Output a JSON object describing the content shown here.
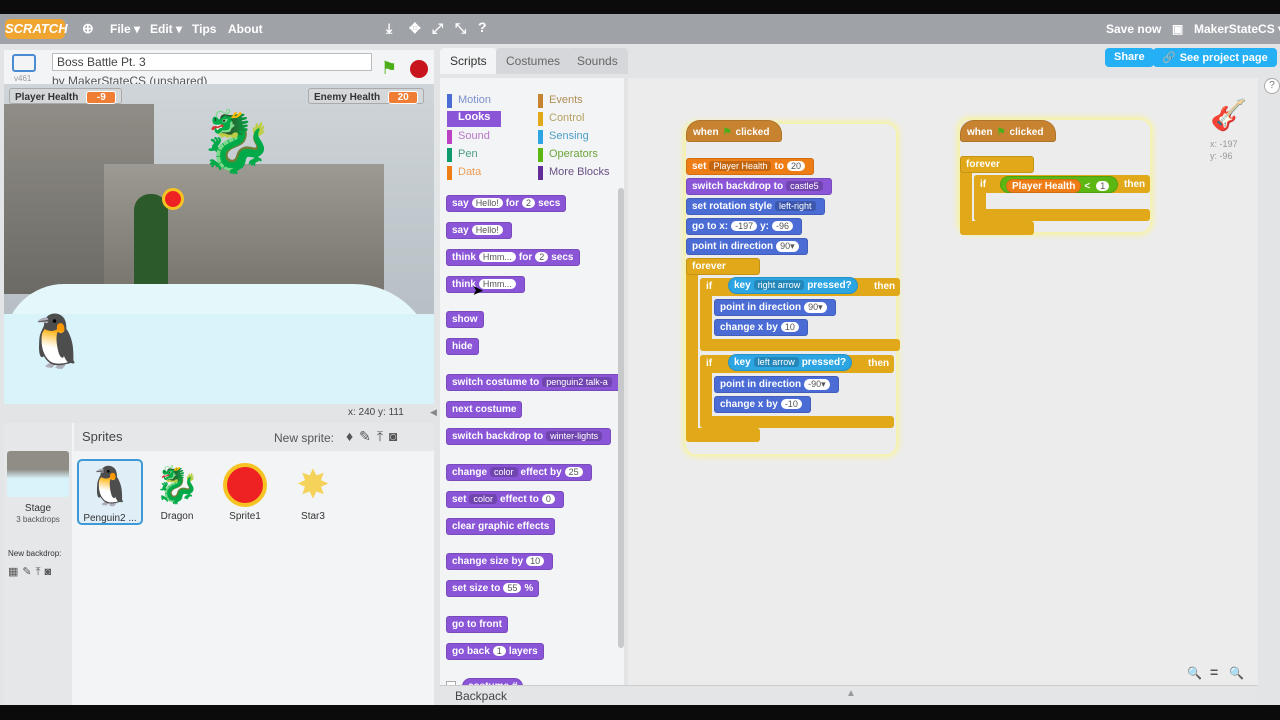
{
  "menu": {
    "logo": "SCRATCH",
    "file": "File ▾",
    "edit": "Edit ▾",
    "tips": "Tips",
    "about": "About",
    "save_now": "Save now",
    "user": "MakerStateCS ▾"
  },
  "project": {
    "title": "Boss Battle Pt. 3",
    "byline": "by MakerStateCS (unshared)",
    "version": "v461"
  },
  "buttons": {
    "share": "Share",
    "see_project_page": "See project page"
  },
  "stage": {
    "player_health_label": "Player Health",
    "player_health_value": "-9",
    "enemy_health_label": "Enemy Health",
    "enemy_health_value": "20",
    "mouse_xy": "x: 240   y: 111"
  },
  "sprites": {
    "header": "Sprites",
    "new_sprite": "New sprite:",
    "stage_label": "Stage",
    "backdrops": "3 backdrops",
    "new_backdrop": "New backdrop:",
    "items": [
      {
        "name": "Penguin2 ..."
      },
      {
        "name": "Dragon"
      },
      {
        "name": "Sprite1"
      },
      {
        "name": "Star3"
      }
    ]
  },
  "tabs": {
    "scripts": "Scripts",
    "costumes": "Costumes",
    "sounds": "Sounds"
  },
  "categories": [
    "Motion",
    "Looks",
    "Sound",
    "Pen",
    "Data",
    "Events",
    "Control",
    "Sensing",
    "Operators",
    "More Blocks"
  ],
  "palette": {
    "say_for": "say",
    "hello": "Hello!",
    "for": "for",
    "two": "2",
    "secs": "secs",
    "say": "say",
    "think_for": "think",
    "hmm": "Hmm...",
    "think": "think",
    "show": "show",
    "hide": "hide",
    "switch_costume": "switch costume to",
    "costume_val": "penguin2 talk-a",
    "next_costume": "next costume",
    "switch_backdrop": "switch backdrop to",
    "backdrop_val": "winter-lights",
    "change_effect": "change",
    "color": "color",
    "effect_by": "effect by",
    "twentyfive": "25",
    "set_effect": "set",
    "effect_to": "effect to",
    "zero": "0",
    "clear_effects": "clear graphic effects",
    "change_size": "change size by",
    "ten": "10",
    "set_size": "set size to",
    "fiftyfive": "55",
    "pct": "%",
    "go_front": "go to front",
    "go_back": "go back",
    "one": "1",
    "layers": "layers",
    "costume_num": "costume #"
  },
  "script1": {
    "when": "when",
    "clicked": "clicked",
    "set": "set",
    "var": "Player Health",
    "to": "to",
    "twenty": "20",
    "switch_backdrop": "switch backdrop to",
    "backdrop": "castle5",
    "rotation": "set rotation style",
    "rot_val": "left-right",
    "goto": "go to x:",
    "x": "-197",
    "y_label": "y:",
    "y": "-96",
    "point": "point in direction",
    "dir": "90▾",
    "forever": "forever",
    "if": "if",
    "key": "key",
    "right": "right arrow",
    "pressed": "pressed?",
    "then": "then",
    "point2": "point in direction",
    "dir2": "90▾",
    "changex": "change x by",
    "ten": "10",
    "if2": "if",
    "key2": "key",
    "left": "left arrow",
    "pressed2": "pressed?",
    "then2": "then",
    "point3": "point in direction",
    "dir3": "-90▾",
    "changex2": "change x by",
    "neg10": "-10"
  },
  "script2": {
    "when": "when",
    "clicked": "clicked",
    "forever": "forever",
    "if": "if",
    "var": "Player Health",
    "lt": "<",
    "one": "1",
    "then": "then"
  },
  "sprite_info": {
    "x": "x: -197",
    "y": "y: -96"
  },
  "backpack": "Backpack",
  "zoom": {
    "out": "🔍",
    "reset": "=",
    "in": "🔍"
  }
}
